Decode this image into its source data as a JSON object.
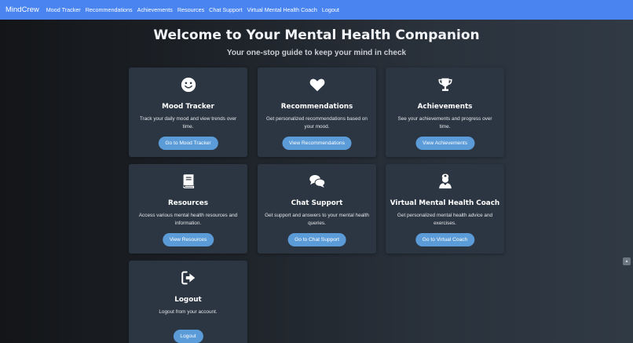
{
  "navbar": {
    "brand": "MindCrew",
    "links": [
      "Mood Tracker",
      "Recommendations",
      "Achievements",
      "Resources",
      "Chat Support",
      "Virtual Mental Health Coach",
      "Logout"
    ]
  },
  "hero": {
    "title": "Welcome to Your Mental Health Companion",
    "subtitle": "Your one-stop guide to keep your mind in check"
  },
  "cards": [
    {
      "icon": "smiley-face-icon",
      "title": "Mood Tracker",
      "desc": "Track your daily mood and view trends over time.",
      "button": "Go to Mood Tracker"
    },
    {
      "icon": "heart-icon",
      "title": "Recommendations",
      "desc": "Get personalized recommendations based on your mood.",
      "button": "View Recommendations"
    },
    {
      "icon": "trophy-icon",
      "title": "Achievements",
      "desc": "See your achievements and progress over time.",
      "button": "View Achievements"
    },
    {
      "icon": "book-icon",
      "title": "Resources",
      "desc": "Access various mental health resources and information.",
      "button": "View Resources"
    },
    {
      "icon": "chat-bubbles-icon",
      "title": "Chat Support",
      "desc": "Get support and answers to your mental health queries.",
      "button": "Go to Chat Support"
    },
    {
      "icon": "doctor-icon",
      "title": "Virtual Mental Health Coach",
      "desc": "Get personalized mental health advice and exercises.",
      "button": "Go to Virtual Coach"
    },
    {
      "icon": "sign-out-icon",
      "title": "Logout",
      "desc": "Logout from your account.",
      "button": "Logout"
    }
  ],
  "colors": {
    "navbar": "#4a84f0",
    "card": "#2c3642",
    "button": "#5b9bd8"
  }
}
